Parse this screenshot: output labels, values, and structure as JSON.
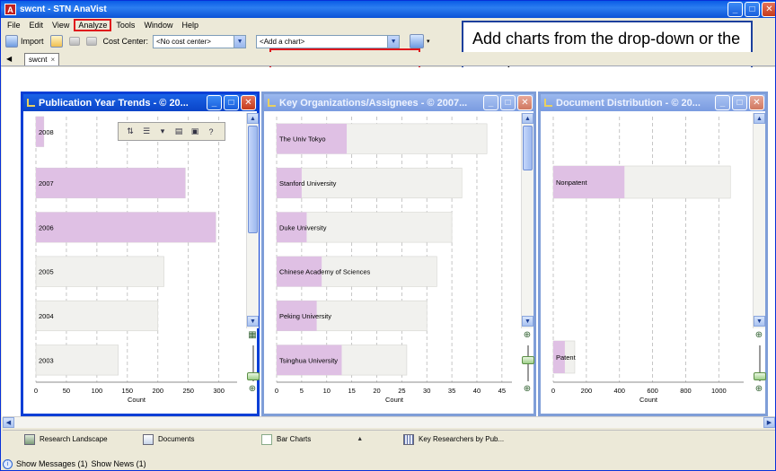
{
  "app": {
    "title": "swcnt - STN AnaVist",
    "icon_letter": "A",
    "window_buttons": [
      "minimize-button",
      "maximize-button",
      "close-button"
    ]
  },
  "menubar": [
    "File",
    "Edit",
    "View",
    "Analyze",
    "Tools",
    "Window",
    "Help"
  ],
  "toolbar": {
    "import_label": "Import",
    "cost_center_label": "Cost Center:",
    "cost_center_value": "<No cost center>",
    "add_chart_value": "<Add a chart>"
  },
  "callout": {
    "text": "Add charts from the drop-down or the Analyze menu."
  },
  "doc_tab": {
    "label": "swcnt",
    "close_glyph": "×"
  },
  "charts": [
    {
      "window_title": "Publication Year Trends - © 20...",
      "chart_type": "horizontal-bar",
      "xlabel": "Count",
      "xticks": [
        0,
        50,
        100,
        150,
        200,
        250,
        300
      ],
      "xlim": [
        0,
        330
      ],
      "categories": [
        "2008",
        "2007",
        "2006",
        "2005",
        "2004",
        "2003"
      ],
      "totals": [
        13,
        245,
        295,
        210,
        200,
        135
      ],
      "highlighted": [
        13,
        245,
        295,
        0,
        0,
        0
      ],
      "colors": {
        "highlight": "#dfc0e4",
        "base": "#f1f1ee"
      }
    },
    {
      "window_title": "Key Organizations/Assignees - © 2007...",
      "chart_type": "horizontal-bar",
      "xlabel": "Count",
      "xticks": [
        0,
        5,
        10,
        15,
        20,
        25,
        30,
        35,
        40,
        45
      ],
      "xlim": [
        0,
        47
      ],
      "categories": [
        "The Univ Tokyo",
        "Stanford University",
        "Duke University",
        "Chinese Academy of Sciences",
        "Peking University",
        "Tsinghua University"
      ],
      "totals": [
        42,
        37,
        35,
        32,
        30,
        26
      ],
      "highlighted": [
        14,
        5,
        6,
        9,
        8,
        13
      ],
      "colors": {
        "highlight": "#dfc0e4",
        "base": "#f1f1ee"
      }
    },
    {
      "window_title": "Document Distribution - © 20...",
      "chart_type": "horizontal-bar",
      "xlabel": "Count",
      "xticks": [
        0,
        200,
        400,
        600,
        800,
        1000
      ],
      "xlim": [
        0,
        1150
      ],
      "categories": [
        "Nonpatent",
        "Patent"
      ],
      "totals": [
        1070,
        130
      ],
      "highlighted": [
        430,
        70
      ],
      "colors": {
        "highlight": "#dfc0e4",
        "base": "#f1f1ee"
      }
    }
  ],
  "taskbar": [
    {
      "label": "Research Landscape",
      "icon": "landscape-map-icon"
    },
    {
      "label": "Documents",
      "icon": "documents-icon"
    },
    {
      "label": "Bar Charts",
      "icon": "bar-chart-icon"
    },
    {
      "label": "Key Researchers by Pub...",
      "icon": "table-grid-icon"
    }
  ],
  "status": {
    "messages": "Show Messages (1)",
    "news": "Show News (1)"
  }
}
